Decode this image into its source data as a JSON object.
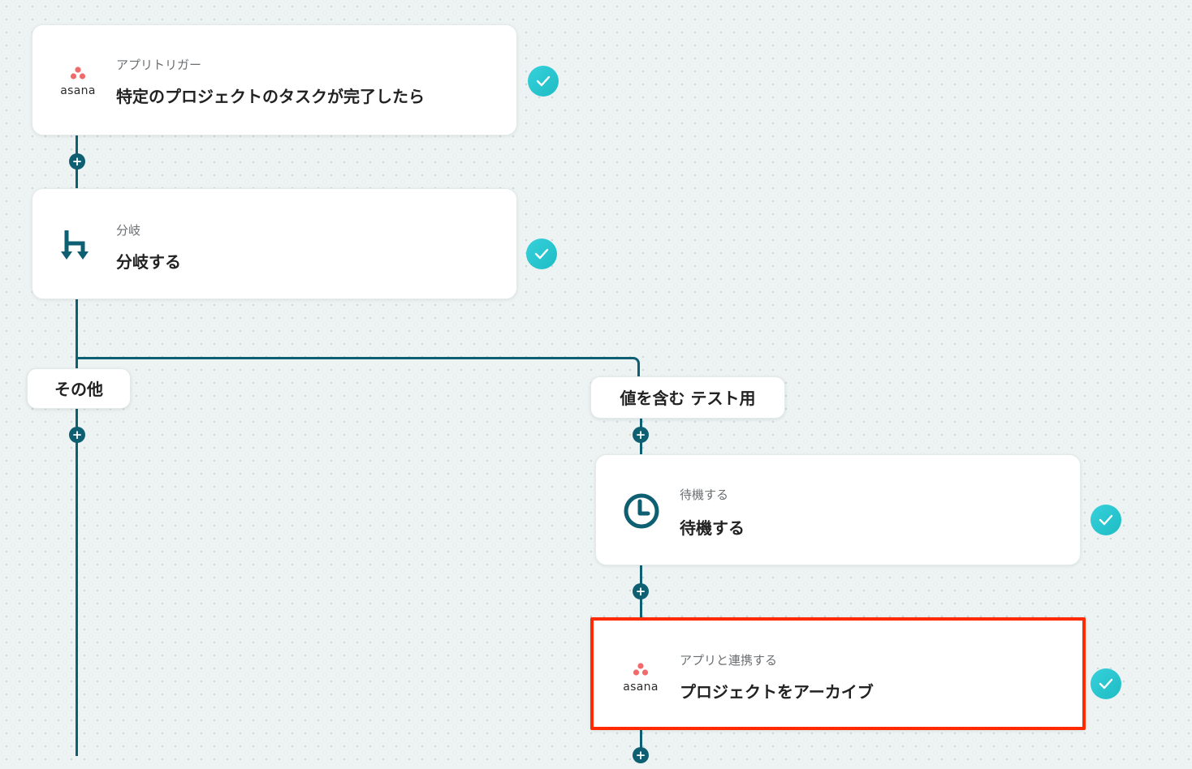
{
  "steps": [
    {
      "sub": "アプリトリガー",
      "title": "特定のプロジェクトのタスクが完了したら",
      "icon": "asana-logo-icon",
      "app": "asana",
      "status": "complete"
    },
    {
      "sub": "分岐",
      "title": "分岐する",
      "icon": "branch-icon",
      "status": "complete"
    },
    {
      "sub": "待機する",
      "title": "待機する",
      "icon": "clock-icon",
      "status": "complete"
    },
    {
      "sub": "アプリと連携する",
      "title": "プロジェクトをアーカイブ",
      "icon": "asana-logo-icon",
      "app": "asana",
      "status": "complete"
    }
  ],
  "branches": {
    "left": "その他",
    "right": "値を含む テスト用"
  },
  "colors": {
    "line": "#0f5f73",
    "check": "#1fc3cb",
    "selected_border": "#ff2a00",
    "asana": "#f06a6a"
  }
}
